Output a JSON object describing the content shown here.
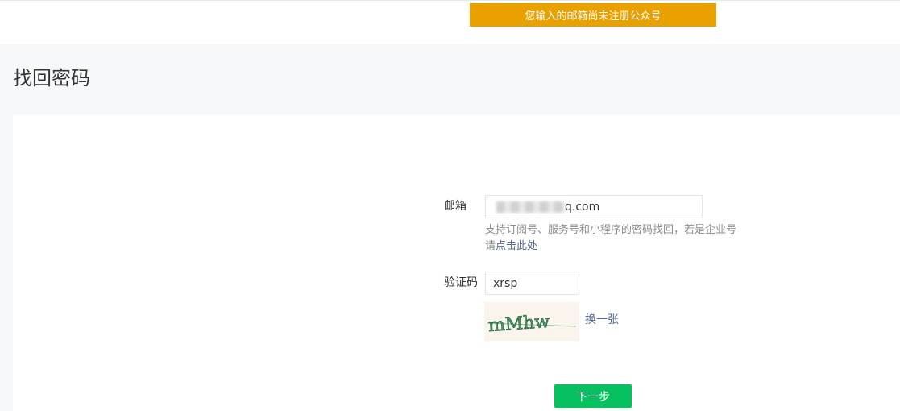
{
  "alert": {
    "message": "您输入的邮箱尚未注册公众号"
  },
  "page": {
    "title": "找回密码"
  },
  "form": {
    "email": {
      "label": "邮箱",
      "value_visible_suffix": "q.com"
    },
    "tip": {
      "text": "支持订阅号、服务号和小程序的密码找回，若是企业号请",
      "link": "点击此处"
    },
    "captcha": {
      "label": "验证码",
      "value": "xrsp",
      "image_text": "mMhw",
      "refresh_link": "换一张"
    },
    "next_button": "下一步"
  },
  "colors": {
    "alert_bg": "#e9a100",
    "primary_button": "#07c160",
    "link": "#576b95",
    "page_bg": "#f6f8f9"
  }
}
